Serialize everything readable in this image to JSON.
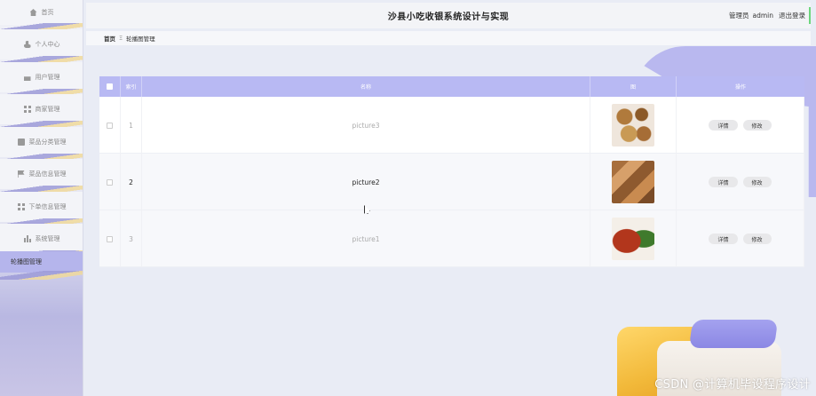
{
  "sidebar": {
    "items": [
      {
        "label": "首页",
        "icon": "home-icon"
      },
      {
        "label": "个人中心",
        "icon": "user-icon"
      },
      {
        "label": "用户管理",
        "icon": "users-icon"
      },
      {
        "label": "商家管理",
        "icon": "grid-icon"
      },
      {
        "label": "菜品分类管理",
        "icon": "document-icon"
      },
      {
        "label": "菜品信息管理",
        "icon": "flag-icon"
      },
      {
        "label": "下单信息管理",
        "icon": "grid-icon"
      },
      {
        "label": "系统管理",
        "icon": "bar-chart-icon"
      },
      {
        "label": "轮播图管理",
        "icon": ""
      }
    ],
    "active_index": 8
  },
  "header": {
    "title": "沙县小吃收银系统设计与实现",
    "user_role": "管理员",
    "username": "admin",
    "logout": "退出登录"
  },
  "breadcrumb": {
    "home": "首页",
    "separator": "Ξ",
    "current": "轮播图管理"
  },
  "table": {
    "columns": {
      "index": "索引",
      "name": "名称",
      "image": "图",
      "operation": "操作"
    },
    "rows": [
      {
        "index": "1",
        "name": "picture3"
      },
      {
        "index": "2",
        "name": "picture2"
      },
      {
        "index": "3",
        "name": "picture1"
      }
    ],
    "detail_label": "详情",
    "edit_label": "修改"
  },
  "watermark": "CSDN @计算机毕设程序设计",
  "colors": {
    "accent": "#b8b9f3",
    "active_menu": "#b5b5ec"
  }
}
